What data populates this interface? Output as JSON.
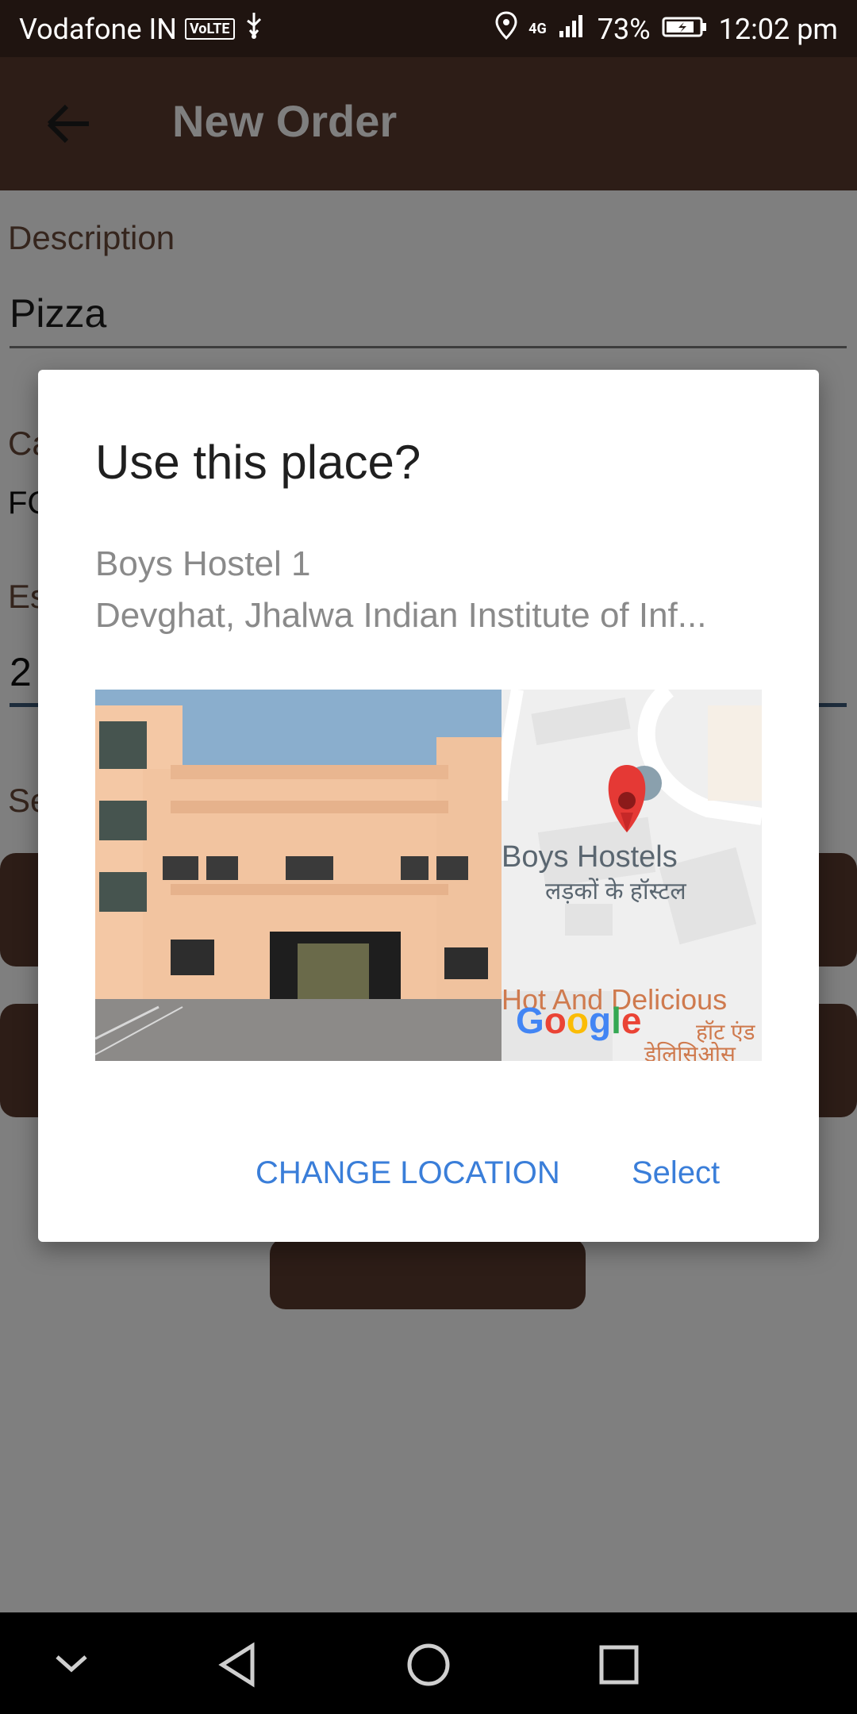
{
  "status_bar": {
    "carrier": "Vodafone IN",
    "volte_badge": "VoLTE",
    "signal_type": "4G",
    "battery_percent": "73%",
    "time": "12:02 pm",
    "icons": [
      "usb-icon",
      "location-icon",
      "signal-icon",
      "battery-icon"
    ]
  },
  "app_bar": {
    "title": "New Order",
    "back_icon": "back-arrow-icon",
    "background": "#5b3a2e"
  },
  "form": {
    "description_label": "Description",
    "description_value": "Pizza",
    "category_label_partial": "Ca",
    "category_value_partial": "FC",
    "estimate_label_partial": "Es",
    "estimate_value_partial": "2",
    "select_label_partial": "Se"
  },
  "dialog": {
    "title": "Use this place?",
    "place_name": "Boys Hostel 1",
    "place_address": "Devghat, Jhalwa Indian Institute of Inf...",
    "map": {
      "label_en": "Boys Hostels",
      "label_hi": "लड़कों के हॉस्टल",
      "nearby_label_en": "Hot And Delicious",
      "nearby_label_hi": "हॉट एंड",
      "nearby_label_hi_2": "डेलिसिओस",
      "logo": "Google"
    },
    "change_location_button": "CHANGE LOCATION",
    "select_button": "Select",
    "accent": "#3a7ed9"
  },
  "nav_bar": {
    "icons": [
      "chevron-down-icon",
      "back-triangle-icon",
      "home-circle-icon",
      "recents-square-icon"
    ]
  }
}
